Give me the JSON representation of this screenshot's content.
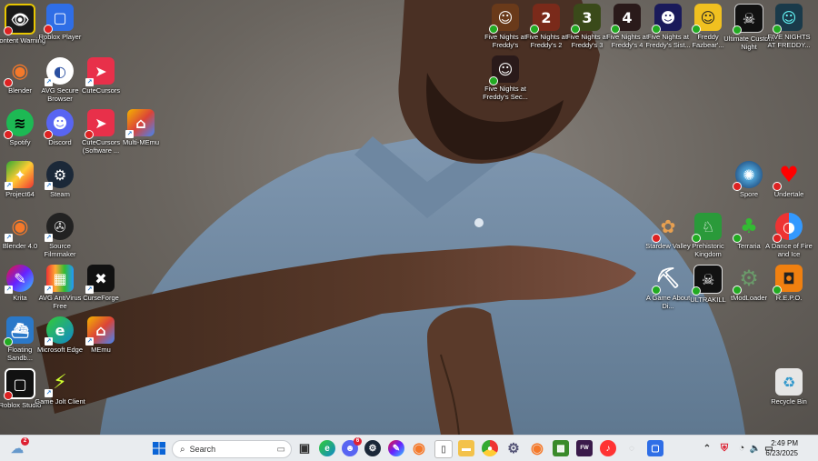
{
  "desktop_icons": {
    "content_warning": "Content Warning",
    "roblox_player": "Roblox Player",
    "blender": "Blender",
    "avg_secure_browser": "AVG Secure Browser",
    "cutecursors": "CuteCursors",
    "spotify": "Spotify",
    "discord": "Discord",
    "cutecursors_software": "CuteCursors (Software ...",
    "multi_memu": "Multi-MEmu",
    "project64": "Project64",
    "steam": "Steam",
    "blender4": "Blender 4.0",
    "source_filmmaker": "Source Filmmaker",
    "krita": "Krita",
    "avg_antivirus": "AVG AntiVirus Free",
    "curseforge": "CurseForge",
    "floating_sandbox": "Floating Sandb...",
    "microsoft_edge": "Microsoft Edge",
    "memu": "MEmu",
    "roblox_studio": "Roblox Studio",
    "game_jolt": "Game Jolt Client",
    "fnaf1": "Five Nights at Freddy's",
    "fnaf2": "Five Nights at Freddy's 2",
    "fnaf3": "Five Nights at Freddy's 3",
    "fnaf4": "Five Nights at Freddy's 4",
    "fnaf_sister": "Five Nights at Freddy's Sist...",
    "freddy_fazbear": "Freddy Fazbear'...",
    "ultimate_custom_night": "Ultimate Custom Night",
    "fnaf_world": "FIVE NIGHTS AT FREDDY...",
    "fnaf_security": "Five Nights at Freddy's Sec...",
    "spore": "Spore",
    "undertale": "Undertale",
    "stardew": "Stardew Valley",
    "prehistoric_kingdom": "Prehistoric Kingdom",
    "terraria": "Terraria",
    "dance_fire_ice": "A Dance of Fire and Ice",
    "game_about_digging": "A Game About Di...",
    "ultrakill": "ULTRAKILL",
    "tmodloader": "tModLoader",
    "repo": "R.E.P.O.",
    "recycle_bin": "Recycle Bin"
  },
  "fnaf_numbers": {
    "fnaf2": "2",
    "fnaf3": "3",
    "fnaf4": "4"
  },
  "taskbar": {
    "search_placeholder": "Search",
    "weather_badge": "2",
    "discord_badge": "6",
    "time": "2:49 PM",
    "date": "6/23/2025"
  },
  "colors": {
    "taskbar_bg": "#e9ecef",
    "accent_windows": "#0a64d6"
  }
}
